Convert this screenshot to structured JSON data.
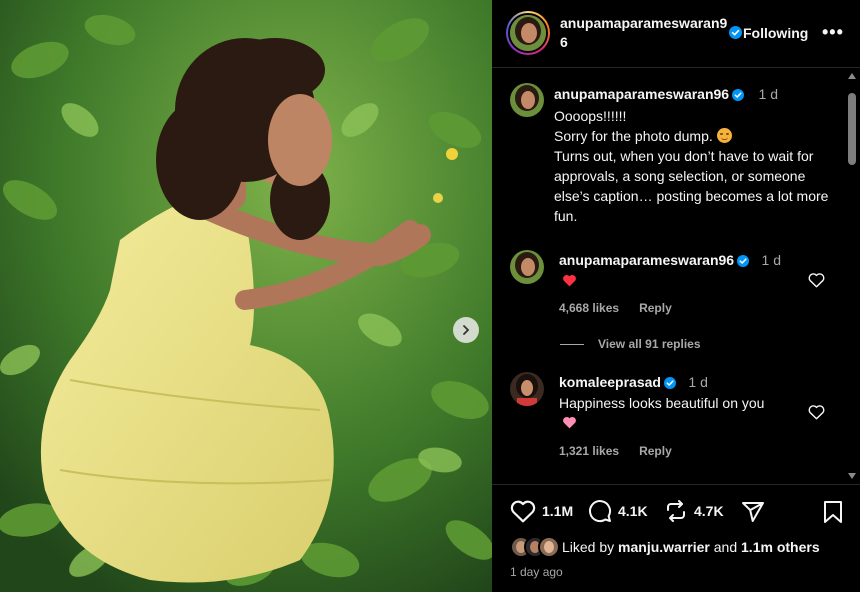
{
  "icons": {
    "next": "chevron-right-icon",
    "verified": "verified-badge-icon",
    "more": "more-options-icon",
    "heart": "heart-icon",
    "comment": "comment-icon",
    "repost": "repost-icon",
    "share": "share-icon",
    "save": "bookmark-icon",
    "emoji_blush": "smiling-face-emoji",
    "emoji_heart_red": "red-heart-emoji",
    "emoji_heart_pink": "pink-heart-emoji"
  },
  "colors": {
    "verified": "#0095f6",
    "background": "#000000",
    "secondary_text": "#a8a8a8",
    "heart_red": "#ff3040",
    "heart_pink": "#ff8fb4"
  },
  "header": {
    "username": "anupamaparameswaran96",
    "follow_label": "Following",
    "more_label": "•••"
  },
  "caption": {
    "username": "anupamaparameswaran96",
    "time": "1 d",
    "lines": [
      "Oooops!!!!!!",
      "Sorry for the photo dump.",
      "Turns out, when you don’t have to wait for approvals, a song selection, or someone else’s caption… posting becomes a lot more fun."
    ]
  },
  "comments": [
    {
      "username": "anupamaparameswaran96",
      "time": "1 d",
      "text": "",
      "likes": "4,668 likes",
      "reply_label": "Reply"
    },
    {
      "username": "komaleeprasad",
      "time": "1 d",
      "text": "Happiness looks beautiful on you",
      "likes": "1,321 likes",
      "reply_label": "Reply"
    }
  ],
  "view_replies": "View all 91 replies",
  "actions": {
    "likes": "1.1M",
    "comments": "4.1K",
    "reposts": "4.7K"
  },
  "liked_by": {
    "prefix": "Liked by",
    "user": "manju.warrier",
    "and": "and",
    "others": "1.1m others"
  },
  "posted_ago": "1 day ago"
}
